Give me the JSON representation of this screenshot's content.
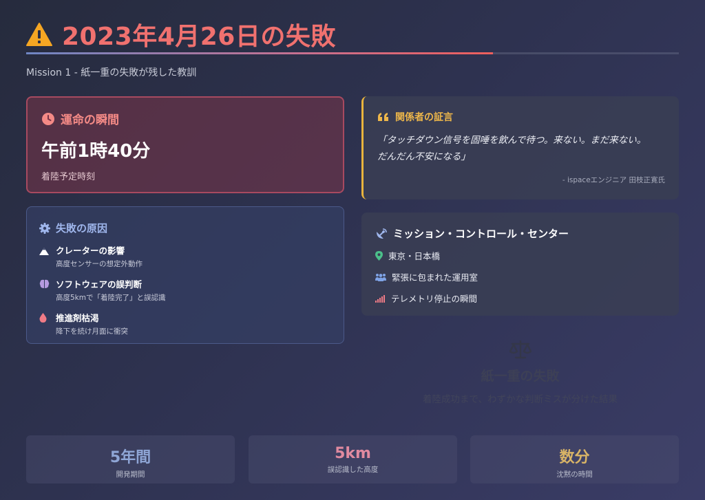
{
  "header": {
    "title": "2023年4月26日の失敗",
    "subtitle": "Mission 1 - 紙一重の失敗が残した教訓",
    "progress_fraction": 0.715
  },
  "fate_card": {
    "heading": "運命の瞬間",
    "time": "午前1時40分",
    "caption": "着陸予定時刻",
    "icon": "clock-icon"
  },
  "quote_card": {
    "heading": "関係者の証言",
    "text_line1": "「タッチダウン信号を固唾を飲んで待つ。来ない。まだ来ない。",
    "text_line2": "だんだん不安になる」",
    "author": "- ispaceエンジニア 田枝正寛氏",
    "icon": "quote-icon"
  },
  "cause_card": {
    "heading": "失敗の原因",
    "icon": "gear-icon",
    "items": [
      {
        "title": "クレーターの影響",
        "desc": "高度センサーの想定外動作",
        "icon": "mountain-icon"
      },
      {
        "title": "ソフトウェアの誤判断",
        "desc": "高度5kmで「着陸完了」と誤認識",
        "icon": "brain-icon"
      },
      {
        "title": "推進剤枯渇",
        "desc": "降下を続け月面に衝突",
        "icon": "drop-icon"
      }
    ]
  },
  "mission_card": {
    "heading": "ミッション・コントロール・センター",
    "icon": "satellite-dish-icon",
    "items": [
      {
        "text": "東京・日本橋",
        "icon": "map-pin-icon"
      },
      {
        "text": "緊張に包まれた運用室",
        "icon": "users-icon"
      },
      {
        "text": "テレメトリ停止の瞬間",
        "icon": "signal-icon"
      }
    ]
  },
  "balance": {
    "title": "紙一重の失敗",
    "desc": "着陸成功まで、わずかな判断ミスが分けた結果",
    "icon": "balance-scale-icon"
  },
  "stats": [
    {
      "value": "5年間",
      "label": "開発期間",
      "color": "#8fa6d6"
    },
    {
      "value": "5km",
      "label": "誤認識した高度",
      "color": "#e08aa0"
    },
    {
      "value": "数分",
      "label": "沈黙の時間",
      "color": "#d9b466"
    }
  ],
  "colors": {
    "accent_red": "#f0716f",
    "accent_gold": "#eeb74a",
    "accent_blue": "#9fb6ec"
  }
}
